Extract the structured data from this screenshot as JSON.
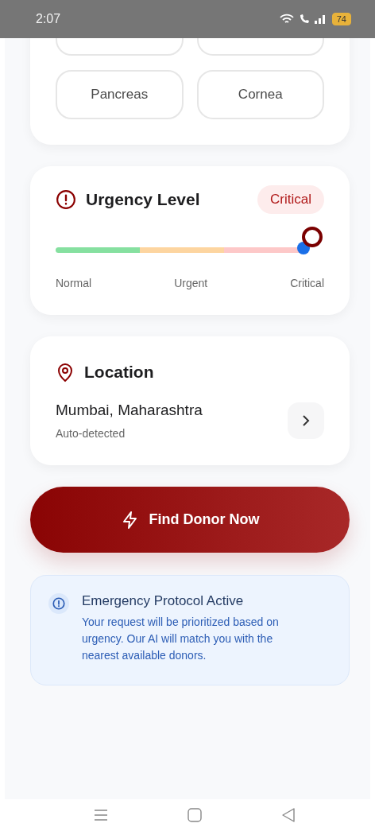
{
  "status_bar": {
    "time": "2:07",
    "battery": "74"
  },
  "organ_card": {
    "options": [
      {
        "selected": false
      },
      {
        "selected": false
      },
      {
        "label": "Pancreas",
        "selected": false
      },
      {
        "label": "Cornea",
        "selected": false
      }
    ]
  },
  "urgency": {
    "title": "Urgency Level",
    "badge": "Critical",
    "level": 1,
    "scale": [
      "Normal",
      "Urgent",
      "Critical"
    ]
  },
  "location": {
    "title": "Location",
    "value": "Mumbai, Maharashtra",
    "note": "Auto-detected"
  },
  "action_button": {
    "label": "Find Donor Now"
  },
  "notice": {
    "title": "Emergency Protocol Active",
    "body": "Your request will be prioritized based on urgency. Our AI will match you with the nearest available donors."
  }
}
